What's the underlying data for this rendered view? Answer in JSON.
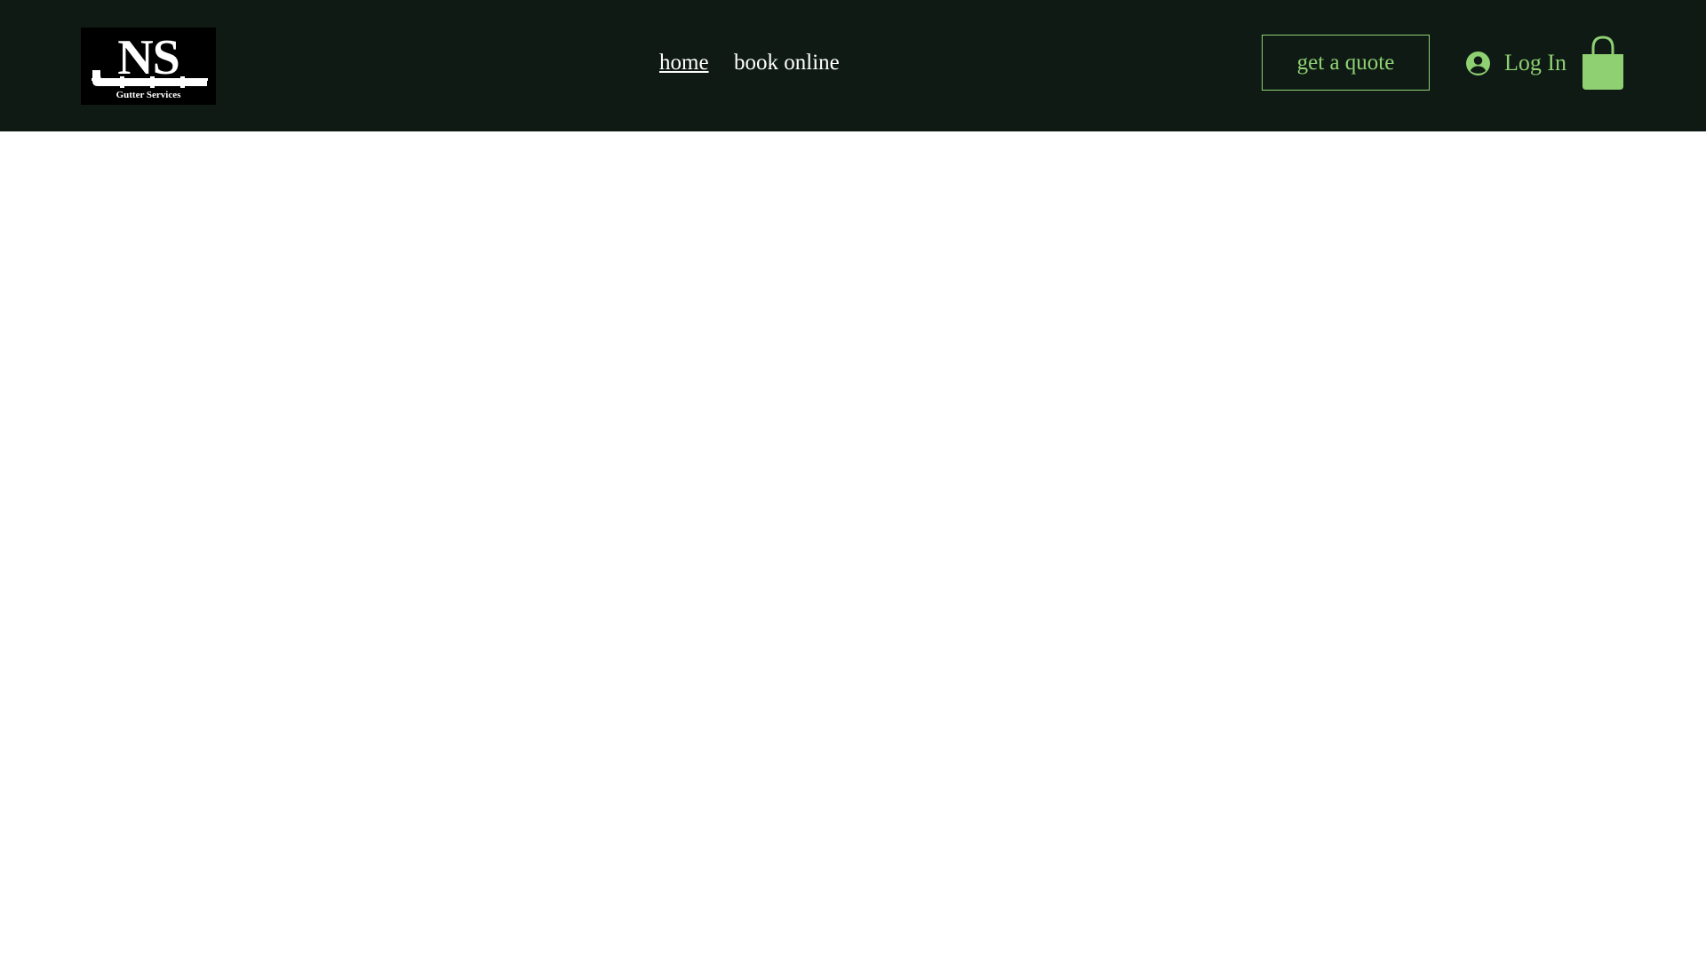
{
  "header": {
    "logo": {
      "main_text": "NS",
      "sub_text": "Gutter Services"
    },
    "nav": [
      {
        "label": "home",
        "active": true
      },
      {
        "label": "book online",
        "active": false
      }
    ],
    "cta_label": "get a quote",
    "login_label": "Log In",
    "cart_count": "",
    "icons": {
      "login": "user-circle-icon",
      "cart": "shopping-bag-icon"
    }
  },
  "colors": {
    "header_bg": "#0f1a14",
    "accent": "#8ed072",
    "nav_text": "#ffffff",
    "page_bg": "#ffffff"
  }
}
